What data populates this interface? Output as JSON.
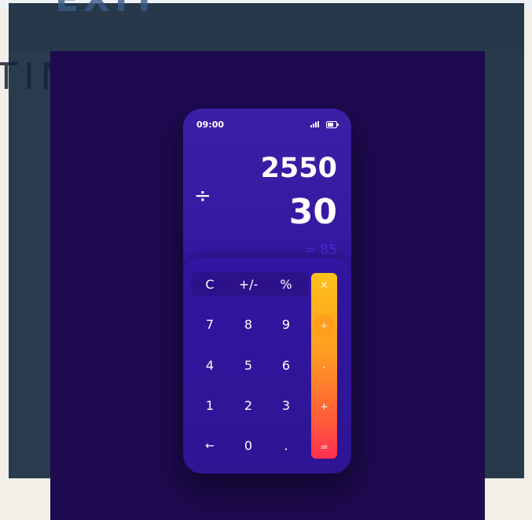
{
  "background": {
    "logo_text": "EXIT",
    "tagline": "TING MINDS"
  },
  "status_bar": {
    "time": "09:00",
    "signal_icon": "signal-icon",
    "battery_icon": "battery-icon"
  },
  "display": {
    "operator": "÷",
    "first_operand": "2550",
    "second_operand": "30",
    "result": "= 85"
  },
  "keypad": {
    "function_keys": [
      "C",
      "+/-",
      "%"
    ],
    "rows": [
      [
        "7",
        "8",
        "9"
      ],
      [
        "4",
        "5",
        "6"
      ],
      [
        "1",
        "2",
        "3"
      ],
      [
        "←",
        "0",
        "."
      ]
    ],
    "operators": [
      "×",
      "÷",
      "-",
      "+",
      "="
    ],
    "active_operator": "÷"
  },
  "colors": {
    "stage_bg": "#1e0a4f",
    "phone_bg": "#3b1fa6",
    "result_text": "#4b2be0",
    "operator_gradient_top": "#ffc21a",
    "operator_gradient_bottom": "#ff2f52"
  }
}
